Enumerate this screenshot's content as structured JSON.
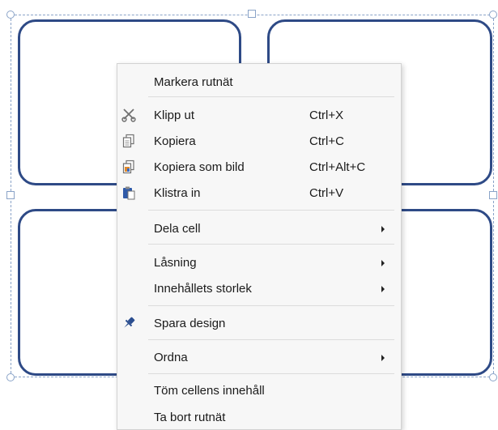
{
  "context_menu": {
    "items": [
      {
        "label": "Markera rutnät",
        "shortcut": "",
        "icon": "",
        "submenu": false
      },
      {
        "label": "Klipp ut",
        "shortcut": "Ctrl+X",
        "icon": "scissors-icon",
        "submenu": false
      },
      {
        "label": "Kopiera",
        "shortcut": "Ctrl+C",
        "icon": "copy-icon",
        "submenu": false
      },
      {
        "label": "Kopiera som bild",
        "shortcut": "Ctrl+Alt+C",
        "icon": "copy-as-image-icon",
        "submenu": false
      },
      {
        "label": "Klistra in",
        "shortcut": "Ctrl+V",
        "icon": "paste-icon",
        "submenu": false
      },
      {
        "label": "Dela cell",
        "shortcut": "",
        "icon": "",
        "submenu": true
      },
      {
        "label": "Låsning",
        "shortcut": "",
        "icon": "",
        "submenu": true
      },
      {
        "label": "Innehållets storlek",
        "shortcut": "",
        "icon": "",
        "submenu": true
      },
      {
        "label": "Spara design",
        "shortcut": "",
        "icon": "pin-icon",
        "submenu": false
      },
      {
        "label": "Ordna",
        "shortcut": "",
        "icon": "",
        "submenu": true
      },
      {
        "label": "Töm cellens innehåll",
        "shortcut": "",
        "icon": "",
        "submenu": false
      },
      {
        "label": "Ta bort rutnät",
        "shortcut": "",
        "icon": "",
        "submenu": false
      }
    ]
  },
  "colors": {
    "cell_border": "#2e4a86",
    "selection_dashes": "#8aa3c8",
    "menu_background": "#f7f7f7",
    "pin_icon": "#2a4d8f"
  }
}
